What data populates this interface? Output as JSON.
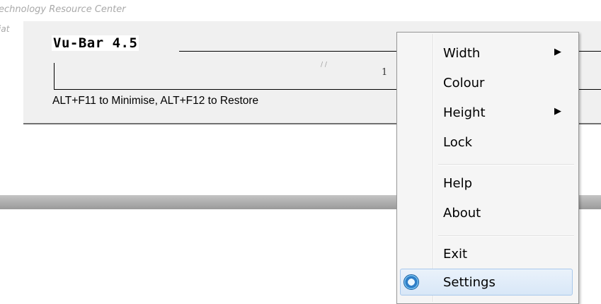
{
  "background": {
    "header_line1": "echnology Resource Center",
    "header_line2": "iat"
  },
  "vubar": {
    "title": "Vu-Bar 4.5",
    "ruler_number": "1",
    "ruler_mark": "/ /",
    "hint": "ALT+F11 to Minimise, ALT+F12 to Restore"
  },
  "menu": {
    "width": "Width",
    "colour": "Colour",
    "height": "Height",
    "lock": "Lock",
    "help": "Help",
    "about": "About",
    "exit": "Exit",
    "settings": "Settings",
    "submenu_arrow": "▶"
  },
  "colors": {
    "selected_fill": "#dbe8f7",
    "selected_border": "#a8c8ec",
    "toolbar_bg": "#f0f0f0"
  }
}
